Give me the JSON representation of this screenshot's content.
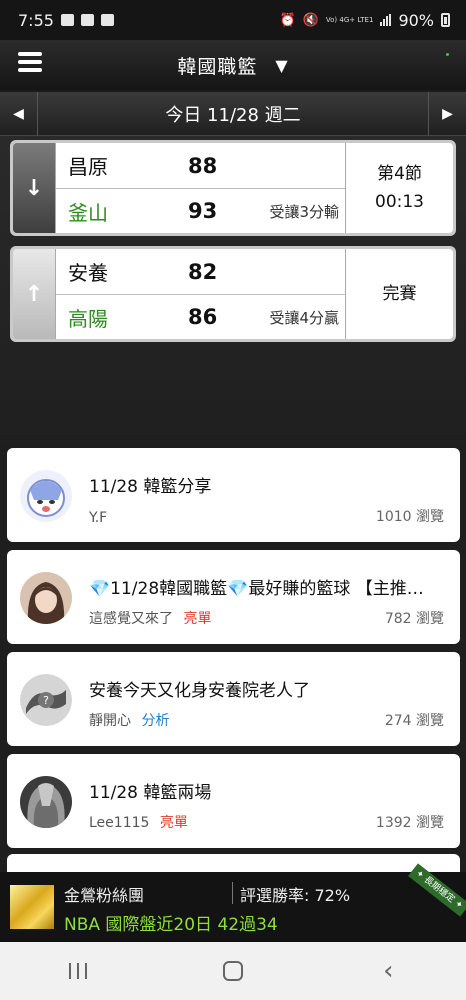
{
  "status_bar": {
    "time": "7:55",
    "network": "Vo) 4G+ LTE1",
    "battery": "90%"
  },
  "header": {
    "title": "韓國職籃",
    "caret": "▼"
  },
  "date_bar": {
    "prev": "◀",
    "label": "今日 11/28 週二",
    "next": "▶"
  },
  "games": [
    {
      "trend_icon": "arrow-down",
      "home": {
        "name": "昌原",
        "score": "88",
        "note": ""
      },
      "away": {
        "name": "釜山",
        "score": "93",
        "note": "受讓3分輸"
      },
      "status_line1": "第4節",
      "status_line2": "00:13"
    },
    {
      "trend_icon": "arrow-up",
      "home": {
        "name": "安養",
        "score": "82",
        "note": ""
      },
      "away": {
        "name": "高陽",
        "score": "86",
        "note": "受讓4分贏"
      },
      "status_line1": "完賽",
      "status_line2": ""
    }
  ],
  "posts": [
    {
      "title": "11/28 韓籃分享",
      "author": "Y.F",
      "tag": "",
      "views": "1010 瀏覽"
    },
    {
      "title": "💎11/28韓國職籃💎最好賺的籃球 【主推…",
      "author": "這感覺又來了",
      "tag": "亮單",
      "views": "782 瀏覽"
    },
    {
      "title": "安養今天又化身安養院老人了",
      "author": "靜開心",
      "tag": "分析",
      "views": "274 瀏覽"
    },
    {
      "title": "11/28 韓籃兩場",
      "author": "Lee1115",
      "tag": "亮單",
      "views": "1392 瀏覽"
    }
  ],
  "banner": {
    "title": "金鶯粉絲團",
    "rate": "評選勝率: 72%",
    "record": "NBA 國際盤近20日 42過34",
    "ribbon": "✦ 長期穩定 ✦"
  },
  "colors": {
    "accent_green": "#2e8b1f",
    "tag_red": "#e03b2a",
    "tag_blue": "#1f7fc9",
    "record_green": "#8ddf3c"
  }
}
